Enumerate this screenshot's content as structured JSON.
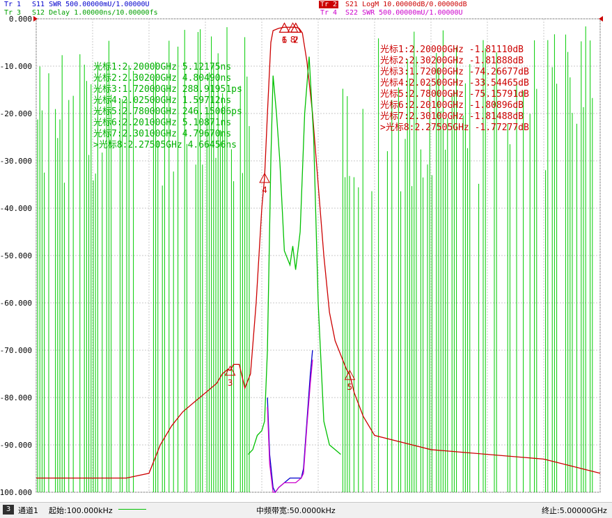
{
  "traces": [
    {
      "id": "tr1",
      "label": "Tr 1",
      "desc": "S11 SWR 500.00000mU/1.00000U",
      "color": "#0000cc"
    },
    {
      "id": "tr2",
      "label": "Tr 2",
      "desc": "S21 LogM 10.00000dB/0.00000dB",
      "color": "#cc0000"
    },
    {
      "id": "tr3",
      "label": "Tr 3",
      "desc": "S12 Delay 1.00000ns/10.00000fs",
      "color": "#00a000"
    },
    {
      "id": "tr4",
      "label": "Tr 4",
      "desc": "S22 SWR 500.00000mU/1.00000U",
      "color": "#cc00cc"
    }
  ],
  "footer": {
    "channel_num": "3",
    "channel": "通道1",
    "start": "起始:100.000kHz",
    "ifbw": "中频带宽:50.0000kHz",
    "stop": "终止:5.00000GHz"
  },
  "marker_table_red": [
    "光标1:2.20000GHz  -1.81110dB",
    "光标2:2.30200GHz  -1.81888dB",
    "光标3:1.72000GHz  -74.26677dB",
    "光标4:2.02500GHz  -33.54465dB",
    "光标5:2.78000GHz  -75.15791dB",
    "光标6:2.20100GHz  -1.80896dB",
    "光标7:2.30100GHz  -1.81488dB",
    ">光标8:2.27505GHz  -1.77277dB"
  ],
  "marker_table_green": [
    "光标1:2.20000GHz 5.12175ns",
    "光标2:2.30200GHz 4.80490ns",
    "光标3:1.72000GHz 288.91951ps",
    "光标4:2.02500GHz 1.59712ns",
    "光标5:2.78000GHz 246.15006ps",
    "光标6:2.20100GHz 5.10871ns",
    "光标7:2.30100GHz 4.79670ns",
    ">光标8:2.27505GHz 4.66456ns"
  ],
  "chart_data": {
    "type": "line",
    "xlabel": "",
    "ylabel": "",
    "xlim": [
      0.0001,
      5.0
    ],
    "ylim": [
      -100,
      0
    ],
    "yticks": [
      "0.000",
      "-10.000",
      "-20.000",
      "-30.000",
      "-40.000",
      "-50.000",
      "-60.000",
      "-70.000",
      "-80.000",
      "-90.000",
      "-100.000"
    ],
    "grid": true,
    "series": [
      {
        "name": "S21",
        "color": "#cc0000",
        "x": [
          0.0001,
          0.3,
          0.8,
          1.0,
          1.1,
          1.2,
          1.3,
          1.4,
          1.5,
          1.6,
          1.65,
          1.7,
          1.72,
          1.75,
          1.8,
          1.85,
          1.9,
          1.95,
          2.0,
          2.025,
          2.05,
          2.08,
          2.1,
          2.15,
          2.2,
          2.25,
          2.275,
          2.3,
          2.33,
          2.36,
          2.4,
          2.45,
          2.5,
          2.55,
          2.6,
          2.65,
          2.7,
          2.75,
          2.78,
          2.82,
          2.9,
          3.0,
          3.5,
          4.0,
          4.5,
          5.0
        ],
        "y": [
          -97,
          -97,
          -97,
          -96,
          -90,
          -86,
          -83,
          -81,
          -79,
          -77,
          -75,
          -74,
          -74.3,
          -73,
          -73,
          -78,
          -75,
          -60,
          -40,
          -33.5,
          -20,
          -5,
          -2.5,
          -2,
          -1.8,
          -1.8,
          -1.77,
          -1.8,
          -2,
          -3,
          -9,
          -20,
          -35,
          -50,
          -62,
          -68,
          -71,
          -74,
          -75.2,
          -79,
          -84,
          -88,
          -91,
          -92,
          -93,
          -96
        ]
      },
      {
        "name": "S11",
        "color": "#0000cc",
        "x": [
          2.05,
          2.07,
          2.1,
          2.12,
          2.15,
          2.2,
          2.25,
          2.3,
          2.35,
          2.37,
          2.4,
          2.43,
          2.45
        ],
        "y": [
          -80,
          -92,
          -99,
          -100,
          -99,
          -98,
          -97,
          -97,
          -97,
          -95,
          -85,
          -75,
          -70
        ]
      },
      {
        "name": "S22",
        "color": "#cc00cc",
        "x": [
          2.05,
          2.07,
          2.1,
          2.12,
          2.15,
          2.2,
          2.25,
          2.3,
          2.35,
          2.37,
          2.4,
          2.43,
          2.45
        ],
        "y": [
          -82,
          -94,
          -100,
          -100,
          -99,
          -98,
          -98,
          -98,
          -97,
          -96,
          -86,
          -77,
          -72
        ]
      },
      {
        "name": "S12 Delay",
        "color": "#00c000",
        "x": [
          1.88,
          1.92,
          1.96,
          2.0,
          2.025,
          2.05,
          2.08,
          2.1,
          2.13,
          2.16,
          2.2,
          2.25,
          2.275,
          2.3,
          2.34,
          2.38,
          2.42,
          2.46,
          2.5,
          2.55,
          2.6,
          2.65,
          2.7
        ],
        "y": [
          -92,
          -91,
          -88,
          -87,
          -85,
          -70,
          -30,
          -12,
          -20,
          -30,
          -49,
          -52,
          -48,
          -53,
          -45,
          -20,
          -8,
          -25,
          -60,
          -85,
          -90,
          -91,
          -92
        ]
      }
    ],
    "markers": [
      {
        "n": "1",
        "x": 2.2,
        "y": -1.8111
      },
      {
        "n": "2",
        "x": 2.302,
        "y": -1.81888
      },
      {
        "n": "3",
        "x": 1.72,
        "y": -74.26677
      },
      {
        "n": "4",
        "x": 2.025,
        "y": -33.54465
      },
      {
        "n": "5",
        "x": 2.78,
        "y": -75.15791
      },
      {
        "n": "6",
        "x": 2.201,
        "y": -1.80896
      },
      {
        "n": "7",
        "x": 2.301,
        "y": -1.81488
      },
      {
        "n": "8",
        "x": 2.27505,
        "y": -1.77277
      }
    ]
  }
}
